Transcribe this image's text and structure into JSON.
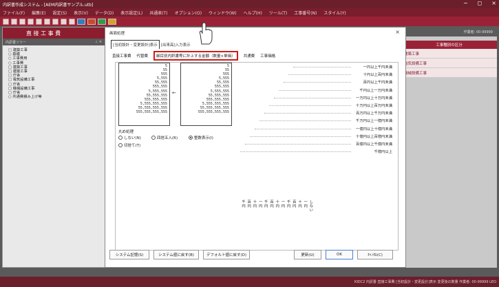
{
  "titlebar": {
    "title": "内訳書作成システム - [AEM内訳書サンプル.utb]",
    "controls": [
      "−",
      "◻",
      "×"
    ]
  },
  "menu": [
    "ファイル(F)",
    "編集(E)",
    "設定(S)",
    "表示(V)",
    "データ(D)",
    "表示設定(L)",
    "共通表(T)",
    "オプション(O)",
    "ウィンドウ(W)",
    "ヘルプ(H)",
    "ツール(T)",
    "工事番号(N)",
    "スタイル(Y)"
  ],
  "left_panel": {
    "header": "直 接 工 事 費",
    "subheader": "内訳書ツリー",
    "tree": [
      "□ 建築工事",
      " ○ 基礎",
      " ○ 工事費用",
      " ○ 工事費",
      "□ 建築工事",
      "  □ 建築工事",
      "   □ 庁舎",
      "  □ 電気設備工事",
      "   □ 庁舎",
      "  □ 機械設備工事",
      "   □ 庁舎",
      " ○ 共通費積み上げ等"
    ]
  },
  "right_panel": {
    "top_label": "作業者: 00-99999",
    "header": "工事種別の区分",
    "rows": [
      "建築工事",
      "電気設備工事",
      "機械設備工事"
    ]
  },
  "dialog": {
    "title": "画面処理",
    "close": "×",
    "tabs": [
      "[当初設計・変更設計]表示",
      "[出来高]入力表示"
    ],
    "subtabs": [
      "直接工事費",
      "代替費",
      "細目別内訳書等に計上する金額（数量×単価）",
      "共通費",
      "工事価格"
    ],
    "numbers_left": [
      "5",
      "55",
      "555",
      "5,555",
      "55,555",
      "555,555",
      "5,555,555",
      "55,555,555",
      "555,555,555",
      "5,555,555,555",
      "55,555,555,555",
      "555,555,555,555"
    ],
    "numbers_right": [
      "5",
      "55",
      "555",
      "5,555",
      "55,555",
      "555,555",
      "5,555,555",
      "55,555,555",
      "555,555,555",
      "5,555,555,555",
      "55,555,555,555",
      "555,555,555,555"
    ],
    "arrow": "←",
    "rounding_title": "丸め処理",
    "rounding_options": [
      {
        "label": "しない(N)",
        "selected": false
      },
      {
        "label": "四捨五入(R)",
        "selected": false
      },
      {
        "label": "整数表示(I)",
        "selected": true
      },
      {
        "label": "切捨て(T)",
        "selected": false
      }
    ],
    "threshold_labels": [
      "一円以上千円未満",
      "十円以上百円未満",
      "百円以上千円未満",
      "千円以上一万円未満",
      "一万円以上十万円未満",
      "十万円以上百万円未満",
      "百万円以上千万円未満",
      "千万円以上一億円未満",
      "一億円以上十億円未満",
      "十億円以上百億円未満",
      "百億円以上千億円未満",
      "千億円以上"
    ],
    "vertical_labels": [
      "千円",
      "百円",
      "十円",
      "一円",
      "千円",
      "百円",
      "十円",
      "一円",
      "千円",
      "百円",
      "十円",
      "一円",
      "しない"
    ],
    "buttons": {
      "system_memory": "システム記憶(S)",
      "system_restore": "システム値に戻す(B)",
      "default_restore": "デフォルト値に戻す(D)",
      "update": "更新(U)",
      "ok": "OK",
      "cancel": "ｷｬﾝｾﾙ(C)"
    }
  },
  "statusbar": "KIDC2 内訳書  直接工事費  [当初設計・変更設計]表示  変更後の数量  作業者: 00-99999 LEO",
  "colors": {
    "accent": "#9a2236",
    "highlight": "#d01a1a"
  }
}
